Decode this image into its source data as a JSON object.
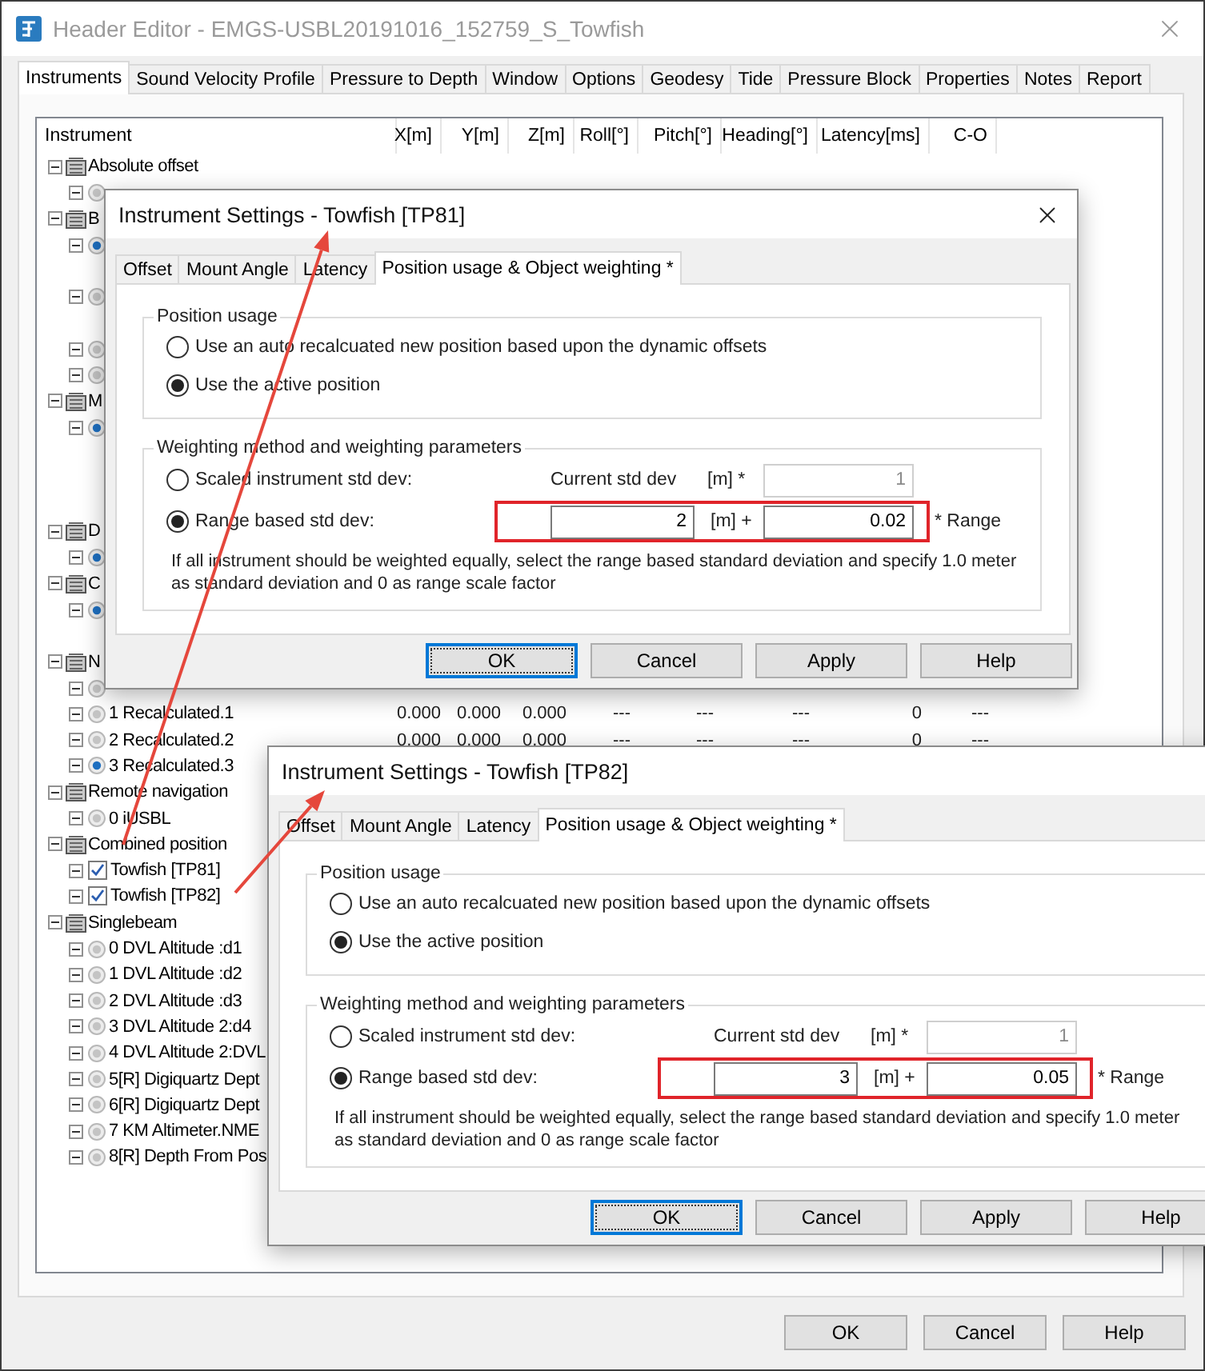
{
  "window": {
    "title": "Header Editor - EMGS-USBL20191016_152759_S_Towfish"
  },
  "tabs": [
    {
      "label": "Instruments",
      "selected": true
    },
    {
      "label": "Sound Velocity Profile",
      "selected": false
    },
    {
      "label": "Pressure to Depth",
      "selected": false
    },
    {
      "label": "Window",
      "selected": false
    },
    {
      "label": "Options",
      "selected": false
    },
    {
      "label": "Geodesy",
      "selected": false
    },
    {
      "label": "Tide",
      "selected": false
    },
    {
      "label": "Pressure Block",
      "selected": false
    },
    {
      "label": "Properties",
      "selected": false
    },
    {
      "label": "Notes",
      "selected": false
    },
    {
      "label": "Report",
      "selected": false
    }
  ],
  "table": {
    "columns": [
      "Instrument",
      "X[m]",
      "Y[m]",
      "Z[m]",
      "Roll[°]",
      "Pitch[°]",
      "Heading[°]",
      "Latency[ms]",
      "C-O"
    ],
    "rows": [
      {
        "label": "Absolute offset",
        "expanded": true,
        "children": [
          {
            "kind": "radio",
            "expanded": true,
            "selected": false
          }
        ]
      },
      {
        "label": "B",
        "expanded": true,
        "children": [
          {
            "kind": "radio",
            "expanded": true,
            "selected": true
          },
          {
            "kind": "blank"
          },
          {
            "kind": "radio",
            "expanded": true,
            "selected": false
          },
          {
            "kind": "blank"
          },
          {
            "kind": "radio",
            "expanded": true,
            "selected": false
          },
          {
            "kind": "radio",
            "expanded": true,
            "selected": false
          }
        ]
      },
      {
        "label": "M",
        "expanded": true,
        "children": [
          {
            "kind": "radio",
            "expanded": true,
            "selected": true
          },
          {
            "kind": "blank"
          },
          {
            "kind": "blank"
          },
          {
            "kind": "blank"
          }
        ]
      },
      {
        "label": "D",
        "expanded": true,
        "children": [
          {
            "kind": "radio",
            "expanded": true,
            "selected": true
          }
        ]
      },
      {
        "label": "C",
        "expanded": true,
        "children": [
          {
            "kind": "radio",
            "expanded": true,
            "selected": true
          },
          {
            "kind": "blank"
          }
        ]
      },
      {
        "label": "N",
        "expanded": true,
        "children": [
          {
            "kind": "radio",
            "expanded": true,
            "selected": false
          },
          {
            "kind": "radio",
            "expanded": true,
            "selected": false,
            "label": "1 Recalculated.1",
            "values": [
              "0.000",
              "0.000",
              "0.000",
              "---",
              "---",
              "---",
              "0",
              "---"
            ]
          },
          {
            "kind": "radio",
            "expanded": true,
            "selected": false,
            "label": "2 Recalculated.2",
            "values": [
              "0.000",
              "0.000",
              "0.000",
              "---",
              "---",
              "---",
              "0",
              "---"
            ]
          },
          {
            "kind": "radio",
            "expanded": true,
            "selected": true,
            "label": "3 Recalculated.3"
          }
        ]
      },
      {
        "label": "Remote navigation",
        "expanded": true,
        "children": [
          {
            "kind": "radio",
            "expanded": true,
            "selected": false,
            "label": "0 iUSBL"
          }
        ]
      },
      {
        "label": "Combined position",
        "expanded": true,
        "children": [
          {
            "kind": "checkbox",
            "expanded": true,
            "checked": true,
            "label": "Towfish [TP81]"
          },
          {
            "kind": "checkbox",
            "expanded": true,
            "checked": true,
            "label": "Towfish [TP82]"
          }
        ]
      },
      {
        "label": "Singlebeam",
        "expanded": true,
        "children": [
          {
            "kind": "radio",
            "expanded": true,
            "selected": false,
            "label": "0 DVL Altitude :d1"
          },
          {
            "kind": "radio",
            "expanded": true,
            "selected": false,
            "label": "1 DVL Altitude :d2"
          },
          {
            "kind": "radio",
            "expanded": true,
            "selected": false,
            "label": "2 DVL Altitude :d3"
          },
          {
            "kind": "radio",
            "expanded": true,
            "selected": false,
            "label": "3 DVL Altitude 2:d4"
          },
          {
            "kind": "radio",
            "expanded": true,
            "selected": false,
            "label": "4 DVL Altitude 2:DVL"
          },
          {
            "kind": "radio",
            "expanded": true,
            "selected": false,
            "label": "5[R] Digiquartz Dept"
          },
          {
            "kind": "radio",
            "expanded": true,
            "selected": false,
            "label": "6[R] Digiquartz Dept"
          },
          {
            "kind": "radio",
            "expanded": true,
            "selected": false,
            "label": "7 KM Altimeter.NME"
          },
          {
            "kind": "radio",
            "expanded": true,
            "selected": false,
            "label": "8[R] Depth From Pos"
          }
        ]
      }
    ]
  },
  "buttons": [
    "OK",
    "Cancel",
    "Help"
  ],
  "dialogs": [
    {
      "title": "Instrument Settings - Towfish [TP81]",
      "close_button": true,
      "tabs": [
        {
          "label": "Offset",
          "selected": false
        },
        {
          "label": "Mount Angle",
          "selected": false
        },
        {
          "label": "Latency",
          "selected": false
        },
        {
          "label": "Position usage & Object weighting *",
          "selected": true
        }
      ],
      "position_usage": {
        "title": "Position usage",
        "options": [
          {
            "label": "Use an auto recalcuated new position based upon the dynamic offsets",
            "selected": false
          },
          {
            "label": "Use the active position",
            "selected": true
          }
        ]
      },
      "weighting": {
        "title": "Weighting method and weighting parameters",
        "options": [
          {
            "label": "Scaled instrument std dev:",
            "selected": false,
            "highlighted": false
          },
          {
            "label": "Range based std dev:",
            "selected": true,
            "highlighted": true
          }
        ],
        "current_label": "Current std dev",
        "current_unit": "[m] *",
        "current_value": "1",
        "std_dev_value": "2",
        "std_dev_unit": "[m] +",
        "range_value": "0.02",
        "range_label": "* Range",
        "note": "If all instrument should be weighted equally, select the range based standard deviation and specify 1.0 meter as standard deviation and 0 as range scale factor"
      },
      "buttons": [
        {
          "label": "OK",
          "default": true
        },
        {
          "label": "Cancel",
          "default": false
        },
        {
          "label": "Apply",
          "default": false
        },
        {
          "label": "Help",
          "default": false
        }
      ]
    },
    {
      "title": "Instrument Settings - Towfish [TP82]",
      "close_button": false,
      "tabs": [
        {
          "label": "Offset",
          "selected": false
        },
        {
          "label": "Mount Angle",
          "selected": false
        },
        {
          "label": "Latency",
          "selected": false
        },
        {
          "label": "Position usage & Object weighting *",
          "selected": true
        }
      ],
      "position_usage": {
        "title": "Position usage",
        "options": [
          {
            "label": "Use an auto recalcuated new position based upon the dynamic offsets",
            "selected": false
          },
          {
            "label": "Use the active position",
            "selected": true
          }
        ]
      },
      "weighting": {
        "title": "Weighting method and weighting parameters",
        "options": [
          {
            "label": "Scaled instrument std dev:",
            "selected": false,
            "highlighted": false
          },
          {
            "label": "Range based std dev:",
            "selected": true,
            "highlighted": true
          }
        ],
        "current_label": "Current std dev",
        "current_unit": "[m] *",
        "current_value": "1",
        "std_dev_value": "3",
        "std_dev_unit": "[m] +",
        "range_value": "0.05",
        "range_label": "* Range",
        "note": "If all instrument should be weighted equally, select the range based standard deviation and specify 1.0 meter as standard deviation and 0 as range scale factor"
      },
      "buttons": [
        {
          "label": "OK",
          "default": true
        },
        {
          "label": "Cancel",
          "default": false
        },
        {
          "label": "Apply",
          "default": false
        },
        {
          "label": "Help",
          "default": false
        }
      ]
    }
  ]
}
